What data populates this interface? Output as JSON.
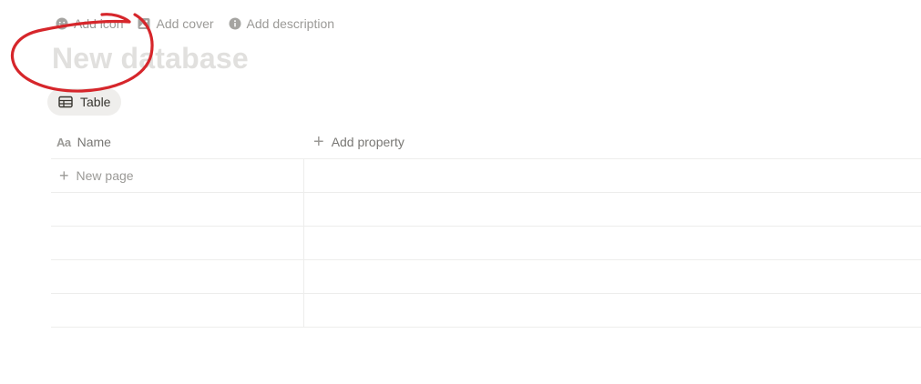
{
  "page_actions": {
    "add_icon": "Add icon",
    "add_cover": "Add cover",
    "add_description": "Add description"
  },
  "database": {
    "title": "New database"
  },
  "views": [
    {
      "label": "Table",
      "icon": "table-icon"
    }
  ],
  "table": {
    "columns": [
      {
        "label": "Name",
        "icon": "text-property-icon",
        "glyph": "Aa"
      }
    ],
    "add_property_label": "Add property",
    "new_page_label": "New page",
    "empty_rows": 4
  },
  "colors": {
    "annotation": "#d6262b",
    "title_placeholder": "#e1e0de",
    "muted_text": "#9b9a97",
    "tab_background": "#efeeec",
    "grid_line": "#ededec"
  }
}
